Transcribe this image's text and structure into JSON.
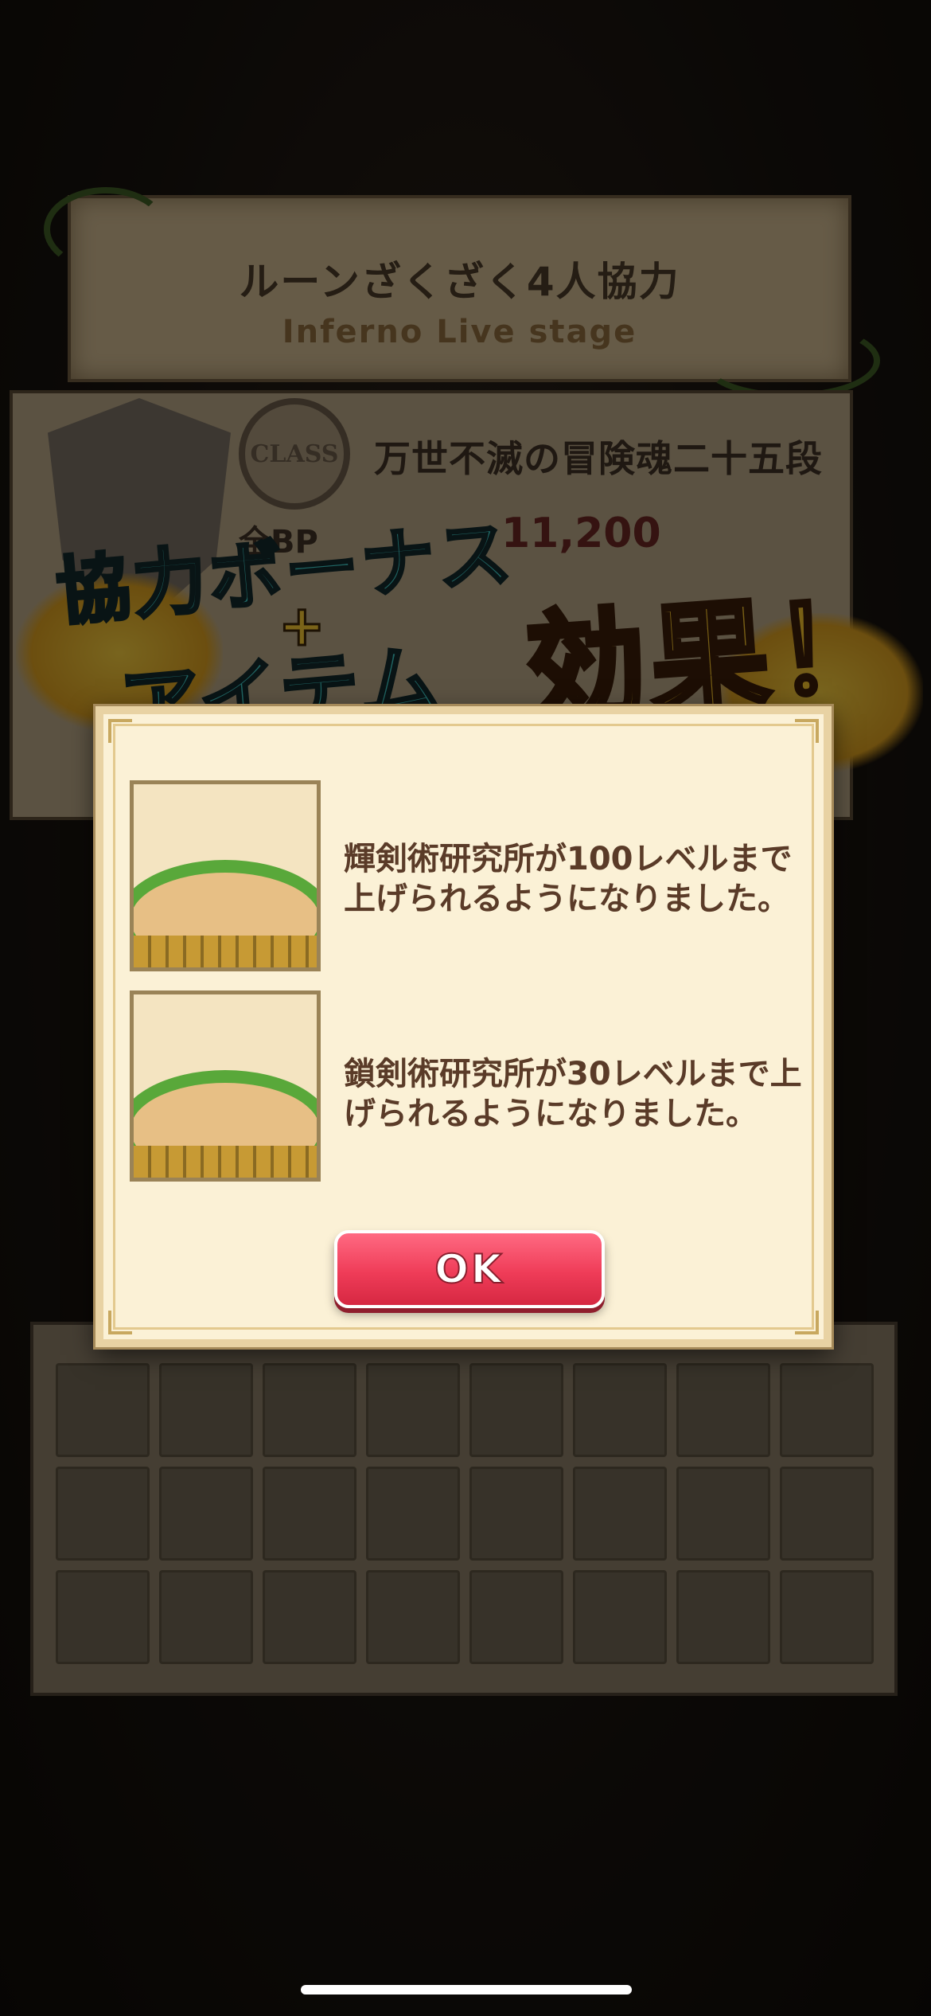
{
  "stage": {
    "title": "ルーンざくざく4人協力",
    "subtitle": "Inferno Live stage"
  },
  "class_panel": {
    "stamp_label": "CLASS",
    "class_name": "万世不滅の冒険魂二十五段",
    "bp_label": "全BP",
    "bp_value": "11,200"
  },
  "bonus_banner": {
    "line1": "協力ボーナス",
    "plus": "+",
    "line2": "アイテム",
    "effect": "効果！"
  },
  "dialog": {
    "items": [
      {
        "icon": "sack-item-icon",
        "text": "輝剣術研究所が100レベルまで上げられるようになりました。"
      },
      {
        "icon": "sack-item-icon",
        "text": "鎖剣術研究所が30レベルまで上げられるようになりました。"
      }
    ],
    "ok_label": "OK"
  },
  "colors": {
    "ok_button": "#ef3c58",
    "dialog_bg": "#fbf1d6",
    "bonus_text": "#3ec8c4",
    "effect_text": "#f3c12b"
  }
}
